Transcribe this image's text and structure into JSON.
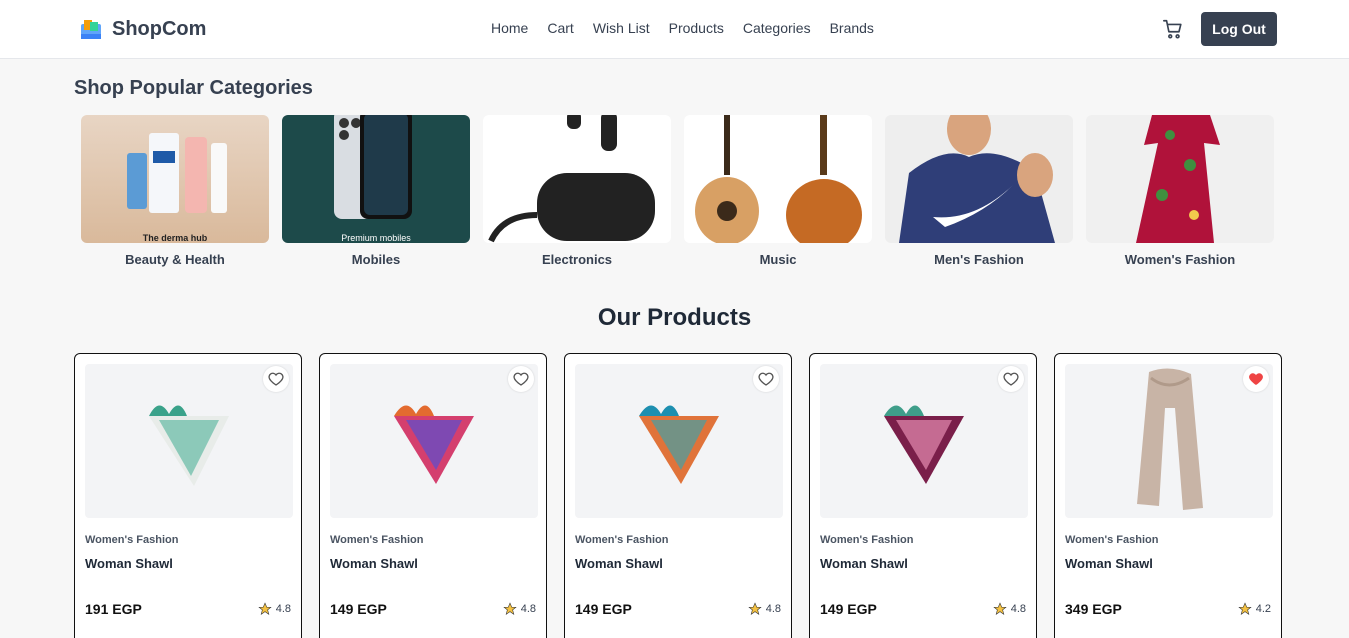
{
  "brand": {
    "name": "ShopCom",
    "logo_icon": "shop-logo-icon"
  },
  "nav": {
    "links": [
      "Home",
      "Cart",
      "Wish List",
      "Products",
      "Categories",
      "Brands"
    ],
    "logout_label": "Log Out"
  },
  "categories_section": {
    "title": "Shop Popular Categories",
    "items": [
      {
        "label": "Beauty & Health",
        "caption": "The derma hub"
      },
      {
        "label": "Mobiles",
        "caption": "Premium mobiles"
      },
      {
        "label": "Electronics"
      },
      {
        "label": "Music"
      },
      {
        "label": "Men's Fashion"
      },
      {
        "label": "Women's Fashion"
      }
    ]
  },
  "products_section": {
    "title": "Our Products",
    "items": [
      {
        "category": "Women's Fashion",
        "title": "Woman Shawl",
        "price": "191 EGP",
        "rating": "4.8",
        "wishlisted": false
      },
      {
        "category": "Women's Fashion",
        "title": "Woman Shawl",
        "price": "149 EGP",
        "rating": "4.8",
        "wishlisted": false
      },
      {
        "category": "Women's Fashion",
        "title": "Woman Shawl",
        "price": "149 EGP",
        "rating": "4.8",
        "wishlisted": false
      },
      {
        "category": "Women's Fashion",
        "title": "Woman Shawl",
        "price": "149 EGP",
        "rating": "4.8",
        "wishlisted": false
      },
      {
        "category": "Women's Fashion",
        "title": "Woman Shawl",
        "price": "349 EGP",
        "rating": "4.2",
        "wishlisted": true
      }
    ]
  },
  "colors": {
    "accent": "#374151",
    "heart_active": "#ef4444",
    "star": "#f5c242"
  }
}
